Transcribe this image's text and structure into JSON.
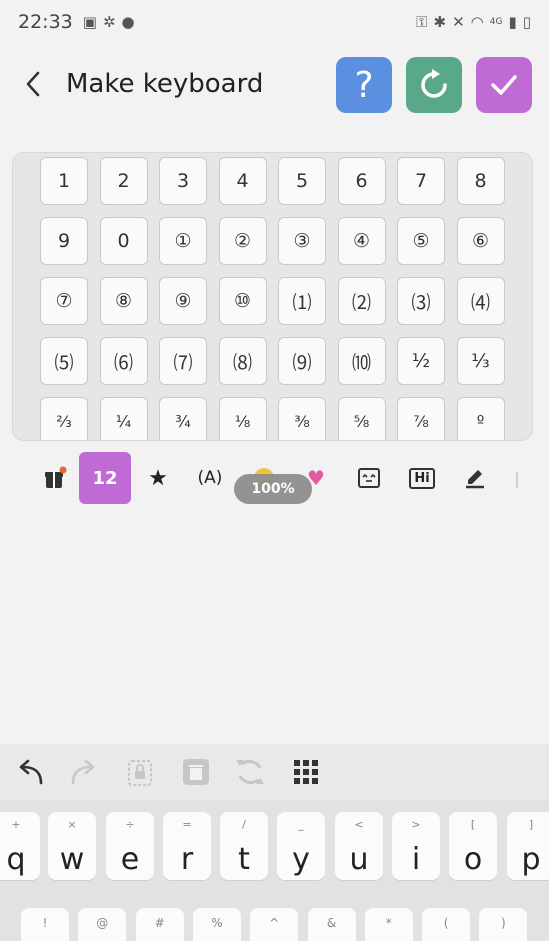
{
  "status": {
    "time": "22:33",
    "network": "4G"
  },
  "header": {
    "title": "Make keyboard",
    "help_label": "?"
  },
  "keys": [
    "1",
    "2",
    "3",
    "4",
    "5",
    "6",
    "7",
    "8",
    "9",
    "0",
    "①",
    "②",
    "③",
    "④",
    "⑤",
    "⑥",
    "⑦",
    "⑧",
    "⑨",
    "⑩",
    "⑴",
    "⑵",
    "⑶",
    "⑷",
    "⑸",
    "⑹",
    "⑺",
    "⑻",
    "⑼",
    "⑽",
    "½",
    "⅓",
    "⅔",
    "¼",
    "¾",
    "⅛",
    "⅜",
    "⅝",
    "⅞",
    "º"
  ],
  "categories": {
    "active_label": "12",
    "letter_label": "(A)",
    "hi_label": "Hi",
    "zoom": "100%"
  },
  "keyboard": {
    "row1": [
      {
        "hint": "+",
        "key": "q"
      },
      {
        "hint": "×",
        "key": "w"
      },
      {
        "hint": "÷",
        "key": "e"
      },
      {
        "hint": "=",
        "key": "r"
      },
      {
        "hint": "/",
        "key": "t"
      },
      {
        "hint": "_",
        "key": "y"
      },
      {
        "hint": "<",
        "key": "u"
      },
      {
        "hint": ">",
        "key": "i"
      },
      {
        "hint": "[",
        "key": "o"
      },
      {
        "hint": "]",
        "key": "p"
      }
    ],
    "row2_hints": [
      "!",
      "@",
      "#",
      "%",
      "^",
      "&",
      "*",
      "(",
      ")"
    ]
  },
  "colors": {
    "help": "#5b8fe0",
    "reset": "#5aa88a",
    "done": "#c06ad6",
    "active_tab": "#c06ad6"
  }
}
